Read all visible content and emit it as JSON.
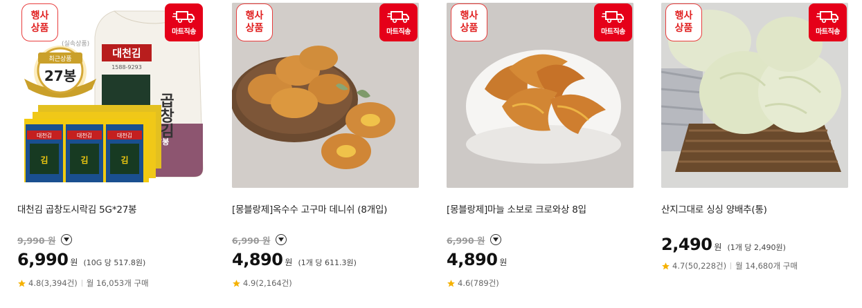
{
  "colors": {
    "accent": "#e50019",
    "event_border": "#e83c3c",
    "star": "#f5b100"
  },
  "products": [
    {
      "event_badge": "행사\n상품",
      "mart_badge": "마트직송",
      "name": "대천김 곱창도시락김 5G*27봉",
      "original_price": "9,990 원",
      "price": "6,990",
      "won": "원",
      "unit_price": "(10G 당 517.8원)",
      "rating": "4.8(3,394건)",
      "monthly": "월 16,053개 구매",
      "image": {
        "tag": "(실속상품)",
        "ribbon_top": "최근상품",
        "ribbon_main": "27봉",
        "pack_brand": "대천김",
        "pack_phone": "1588-9293",
        "pack_vertical": "곱창김",
        "pack_count": "27봉",
        "mini_brand": "대천김",
        "mini_label": "김"
      }
    },
    {
      "event_badge": "행사\n상품",
      "mart_badge": "마트직송",
      "name": "[몽블랑제]옥수수 고구마 데니쉬 (8개입)",
      "original_price": "6,990 원",
      "price": "4,890",
      "won": "원",
      "unit_price": "(1개 당 611.3원)",
      "rating": "4.9(2,164건)",
      "monthly": ""
    },
    {
      "event_badge": "행사\n상품",
      "mart_badge": "마트직송",
      "name": "[몽블랑제]마늘 소보로 크로와상 8입",
      "original_price": "6,990 원",
      "price": "4,890",
      "won": "원",
      "unit_price": "",
      "rating": "4.6(789건)",
      "monthly": ""
    },
    {
      "event_badge": "행사\n상품",
      "mart_badge": "마트직송",
      "name": "산지그대로 싱싱 양배추(통)",
      "original_price": "",
      "price": "2,490",
      "won": "원",
      "unit_price": "(1개 당 2,490원)",
      "rating": "4.7(50,228건)",
      "monthly": "월 14,680개 구매"
    }
  ]
}
